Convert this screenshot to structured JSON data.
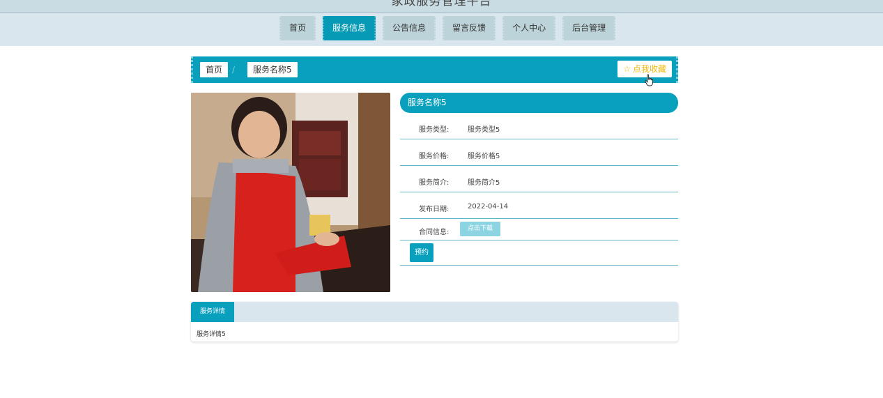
{
  "header": {
    "site_title": "家政服务管理平台"
  },
  "nav": [
    {
      "label": "首页",
      "active": false
    },
    {
      "label": "服务信息",
      "active": true
    },
    {
      "label": "公告信息",
      "active": false
    },
    {
      "label": "留言反馈",
      "active": false
    },
    {
      "label": "个人中心",
      "active": false
    },
    {
      "label": "后台管理",
      "active": false
    }
  ],
  "breadcrumb": {
    "home": "首页",
    "separator": "/",
    "current": "服务名称5"
  },
  "favorite_button": {
    "label": "点我收藏",
    "icon": "star-outline-icon"
  },
  "service": {
    "title": "服务名称5",
    "rows": [
      {
        "label": "服务类型:",
        "value": "服务类型5"
      },
      {
        "label": "服务价格:",
        "value": "服务价格5"
      },
      {
        "label": "服务简介:",
        "value": "服务简介5"
      },
      {
        "label": "发布日期:",
        "value": "2022-04-14"
      }
    ],
    "contract_label": "合同信息:",
    "download_label": "点击下载",
    "book_label": "预约"
  },
  "detail": {
    "tab_label": "服务详情",
    "content": "服务详情5"
  },
  "colors": {
    "accent": "#09a0bd",
    "nav_bg": "#dae6ed",
    "star": "#f2b705"
  }
}
